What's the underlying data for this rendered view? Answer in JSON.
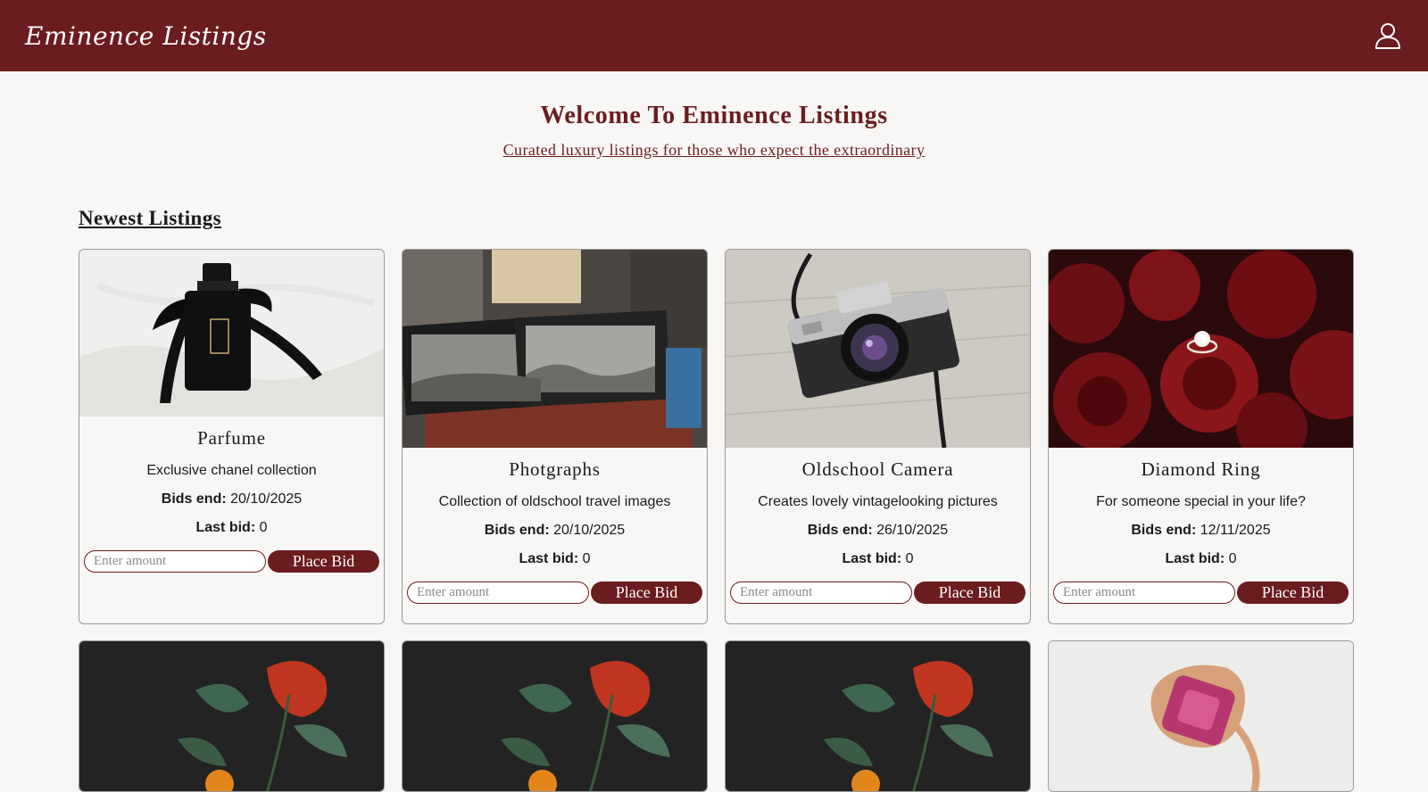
{
  "header": {
    "brand": "Eminence Listings",
    "account_icon": "user-icon"
  },
  "hero": {
    "title": "Welcome To Eminence Listings",
    "subtitle": "Curated luxury listings for those who expect the extraordinary"
  },
  "section": {
    "title": "Newest Listings"
  },
  "labels": {
    "bids_end": "Bids end:",
    "last_bid": "Last bid:",
    "amount_placeholder": "Enter amount",
    "place_bid": "Place Bid"
  },
  "listings": [
    {
      "name": "Parfume",
      "description": "Exclusive chanel collection",
      "bids_end": "20/10/2025",
      "last_bid": "0"
    },
    {
      "name": "Photgraphs",
      "description": "Collection of oldschool travel images",
      "bids_end": "20/10/2025",
      "last_bid": "0"
    },
    {
      "name": "Oldschool Camera",
      "description": "Creates lovely vintagelooking pictures",
      "bids_end": "26/10/2025",
      "last_bid": "0"
    },
    {
      "name": "Diamond Ring",
      "description": "For someone special in your life?",
      "bids_end": "12/11/2025",
      "last_bid": "0"
    }
  ],
  "colors": {
    "brand": "#6b1c1f",
    "background": "#f8f7f5"
  }
}
